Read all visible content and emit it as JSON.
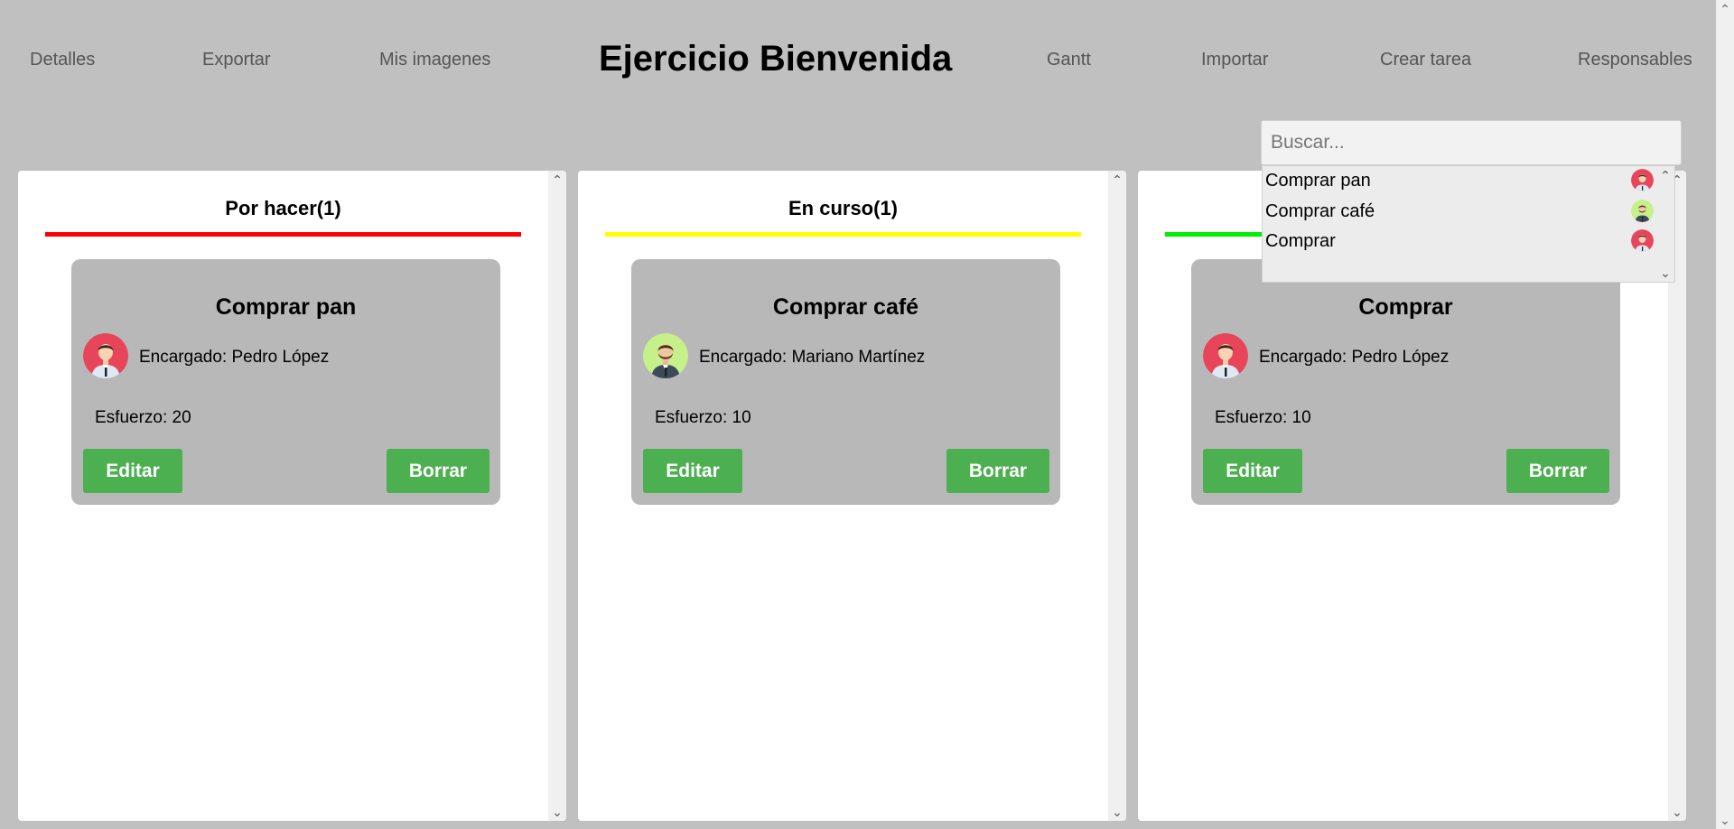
{
  "nav": {
    "left": [
      "Detalles",
      "Exportar",
      "Mis imagenes"
    ],
    "title": "Ejercicio Bienvenida",
    "right": [
      "Gantt",
      "Importar",
      "Crear tarea",
      "Responsables"
    ]
  },
  "search": {
    "placeholder": "Buscar...",
    "value": "",
    "results": [
      {
        "label": "Comprar pan",
        "avatar": "person-red-icon"
      },
      {
        "label": "Comprar café",
        "avatar": "person-green-icon"
      },
      {
        "label": "Comprar",
        "avatar": "person-red-icon"
      }
    ]
  },
  "columns": [
    {
      "title": "Por hacer(1)",
      "bar_color": "#ff0000",
      "cards": [
        {
          "title": "Comprar pan",
          "assignee": "Encargado: Pedro López",
          "effort": "Esfuerzo: 20",
          "avatar": "person-red-icon",
          "edit_label": "Editar",
          "delete_label": "Borrar"
        }
      ]
    },
    {
      "title": "En curso(1)",
      "bar_color": "#ffff00",
      "cards": [
        {
          "title": "Comprar café",
          "assignee": "Encargado: Mariano Martínez",
          "effort": "Esfuerzo: 10",
          "avatar": "person-green-icon",
          "edit_label": "Editar",
          "delete_label": "Borrar"
        }
      ]
    },
    {
      "title": "",
      "bar_color": "#00ee00",
      "cards": [
        {
          "title": "Comprar",
          "assignee": "Encargado: Pedro López",
          "effort": "Esfuerzo: 10",
          "avatar": "person-red-icon",
          "edit_label": "Editar",
          "delete_label": "Borrar"
        }
      ]
    }
  ],
  "colors": {
    "background": "#c0c0c0",
    "button": "#4caf50",
    "card": "#b8b8b8",
    "avatar_red": "#e8455a",
    "avatar_green": "#c6f08a"
  }
}
